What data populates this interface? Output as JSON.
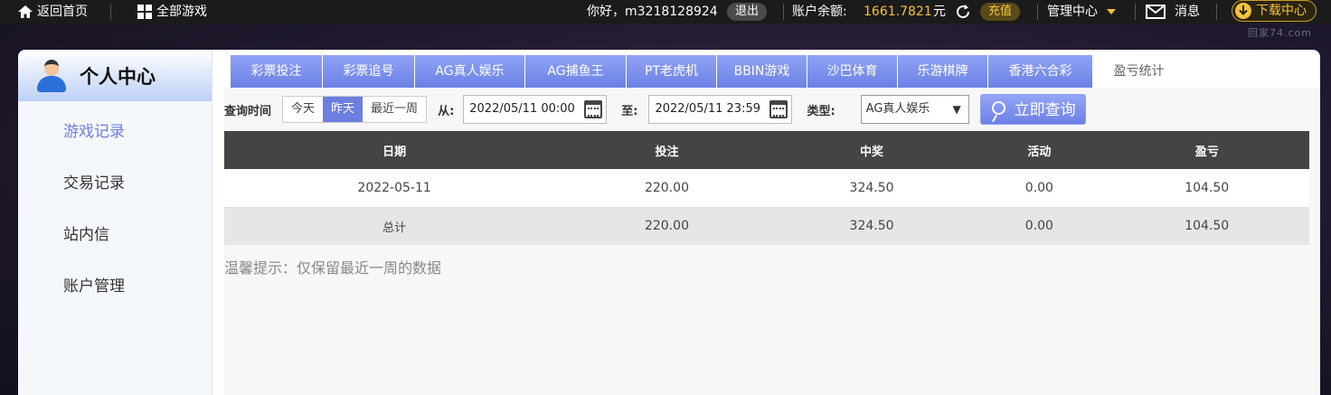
{
  "topbar": {
    "home": "返回首页",
    "all_games": "全部游戏",
    "greeting": "你好，m3218128924",
    "logout": "退出",
    "balance_label": "账户余额:",
    "balance_value": "1661.7821",
    "balance_unit": "元",
    "recharge": "充值",
    "manage": "管理中心",
    "messages": "消息",
    "download": "下载中心"
  },
  "watermark": "回家74.com",
  "sidebar": {
    "title": "个人中心",
    "items": [
      {
        "label": "游戏记录",
        "active": true
      },
      {
        "label": "交易记录",
        "active": false
      },
      {
        "label": "站内信",
        "active": false
      },
      {
        "label": "账户管理",
        "active": false
      }
    ]
  },
  "tabs": [
    {
      "label": "彩票投注"
    },
    {
      "label": "彩票追号"
    },
    {
      "label": "AG真人娱乐"
    },
    {
      "label": "AG捕鱼王"
    },
    {
      "label": "PT老虎机"
    },
    {
      "label": "BBIN游戏"
    },
    {
      "label": "沙巴体育"
    },
    {
      "label": "乐游棋牌"
    },
    {
      "label": "香港六合彩"
    },
    {
      "label": "盈亏统计",
      "active": true
    }
  ],
  "filter": {
    "time_label": "查询时间",
    "ranges": [
      "今天",
      "昨天",
      "最近一周"
    ],
    "selected_range": "昨天",
    "from_label": "从:",
    "from_value": "2022/05/11 00:00",
    "to_label": "至:",
    "to_value": "2022/05/11 23:59",
    "type_label": "类型:",
    "type_value": "AG真人娱乐",
    "query_button": "立即查询"
  },
  "table": {
    "headers": [
      "日期",
      "投注",
      "中奖",
      "活动",
      "盈亏"
    ],
    "rows": [
      [
        "2022-05-11",
        "220.00",
        "324.50",
        "0.00",
        "104.50"
      ],
      [
        "总计",
        "220.00",
        "324.50",
        "0.00",
        "104.50"
      ]
    ]
  },
  "tip": "温馨提示：仅保留最近一周的数据",
  "colors": {
    "accent": "#6d7ee0",
    "gold": "#f3c33b",
    "topbar_bg": "#1b1b1b",
    "table_header_bg": "#444444"
  }
}
